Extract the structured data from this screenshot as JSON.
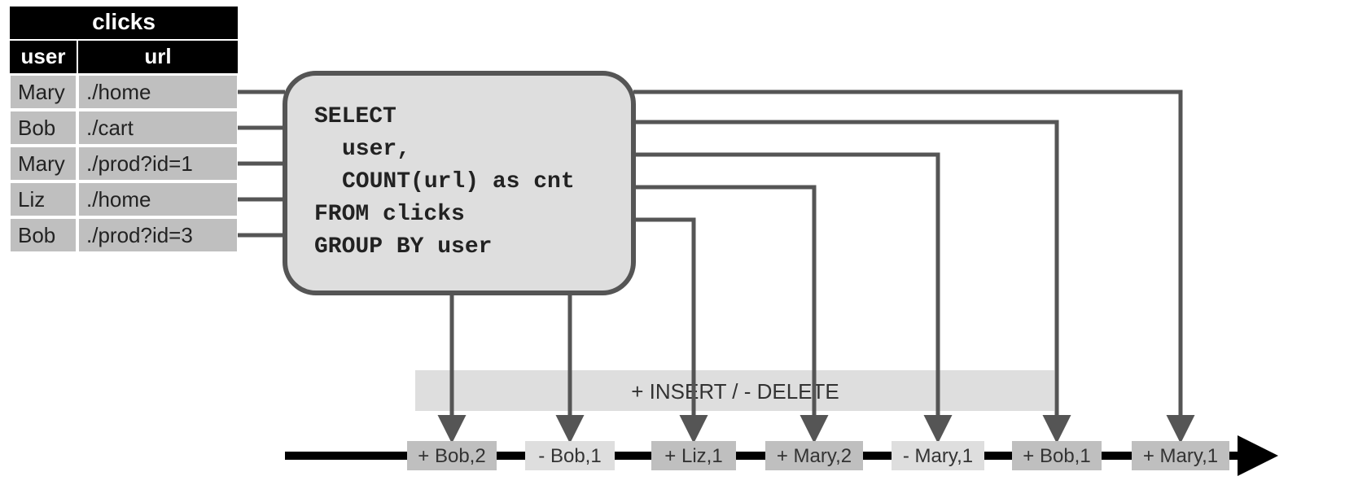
{
  "table": {
    "title": "clicks",
    "columns": [
      "user",
      "url"
    ],
    "rows": [
      {
        "user": "Mary",
        "url": "./home"
      },
      {
        "user": "Bob",
        "url": "./cart"
      },
      {
        "user": "Mary",
        "url": "./prod?id=1"
      },
      {
        "user": "Liz",
        "url": "./home"
      },
      {
        "user": "Bob",
        "url": "./prod?id=3"
      }
    ]
  },
  "sql": {
    "line1": "SELECT",
    "line2": "user,",
    "line3": "COUNT(url) as cnt",
    "line4": "FROM clicks",
    "line5": "GROUP BY user"
  },
  "legend": "+ INSERT / - DELETE",
  "events": [
    {
      "label": "+ Bob,2",
      "shade": "med"
    },
    {
      "label": "- Bob,1",
      "shade": "light"
    },
    {
      "label": "+ Liz,1",
      "shade": "med"
    },
    {
      "label": "+ Mary,2",
      "shade": "med"
    },
    {
      "label": "- Mary,1",
      "shade": "light"
    },
    {
      "label": "+ Bob,1",
      "shade": "med"
    },
    {
      "label": "+ Mary,1",
      "shade": "med"
    }
  ],
  "colors": {
    "black": "#000000",
    "darkGrey": "#555555",
    "medGrey": "#bfbfbf",
    "lightGrey": "#dedede",
    "panelGrey": "#d9d9d9"
  }
}
